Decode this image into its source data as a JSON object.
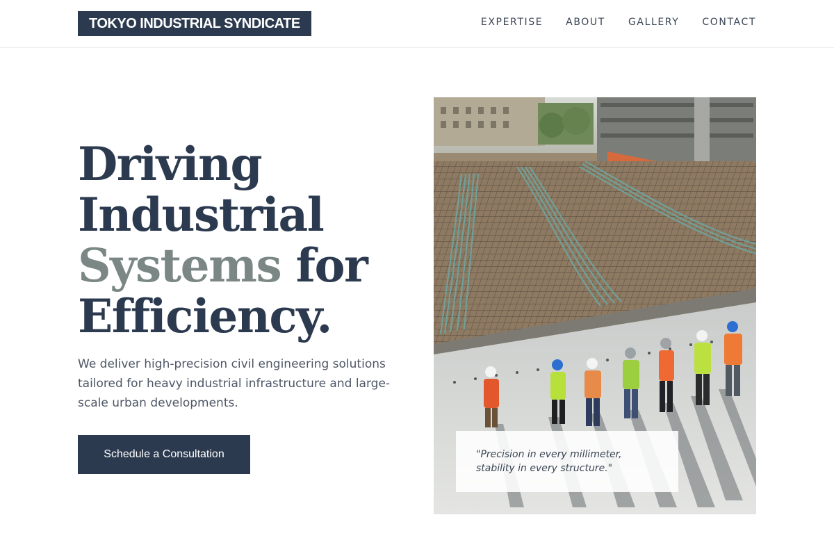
{
  "brand": {
    "logo_text": "TOKYO INDUSTRIAL SYNDICATE"
  },
  "nav": {
    "items": [
      {
        "label": "EXPERTISE"
      },
      {
        "label": "ABOUT"
      },
      {
        "label": "GALLERY"
      },
      {
        "label": "CONTACT"
      }
    ]
  },
  "hero": {
    "title_line1": "Driving",
    "title_line2": "Industrial",
    "title_accent": "Systems",
    "title_line3_rest": " for",
    "title_line4": "Efficiency.",
    "description": "We deliver high-precision civil engineering solutions tailored for heavy industrial infrastructure and large-scale urban developments.",
    "cta_label": "Schedule a Consultation"
  },
  "image_panel": {
    "quote": "\"Precision in every millimeter, stability in every structure.\""
  },
  "colors": {
    "primary": "#2c3a4f",
    "accent_muted": "#7b8784",
    "text_body": "#4d5766"
  }
}
